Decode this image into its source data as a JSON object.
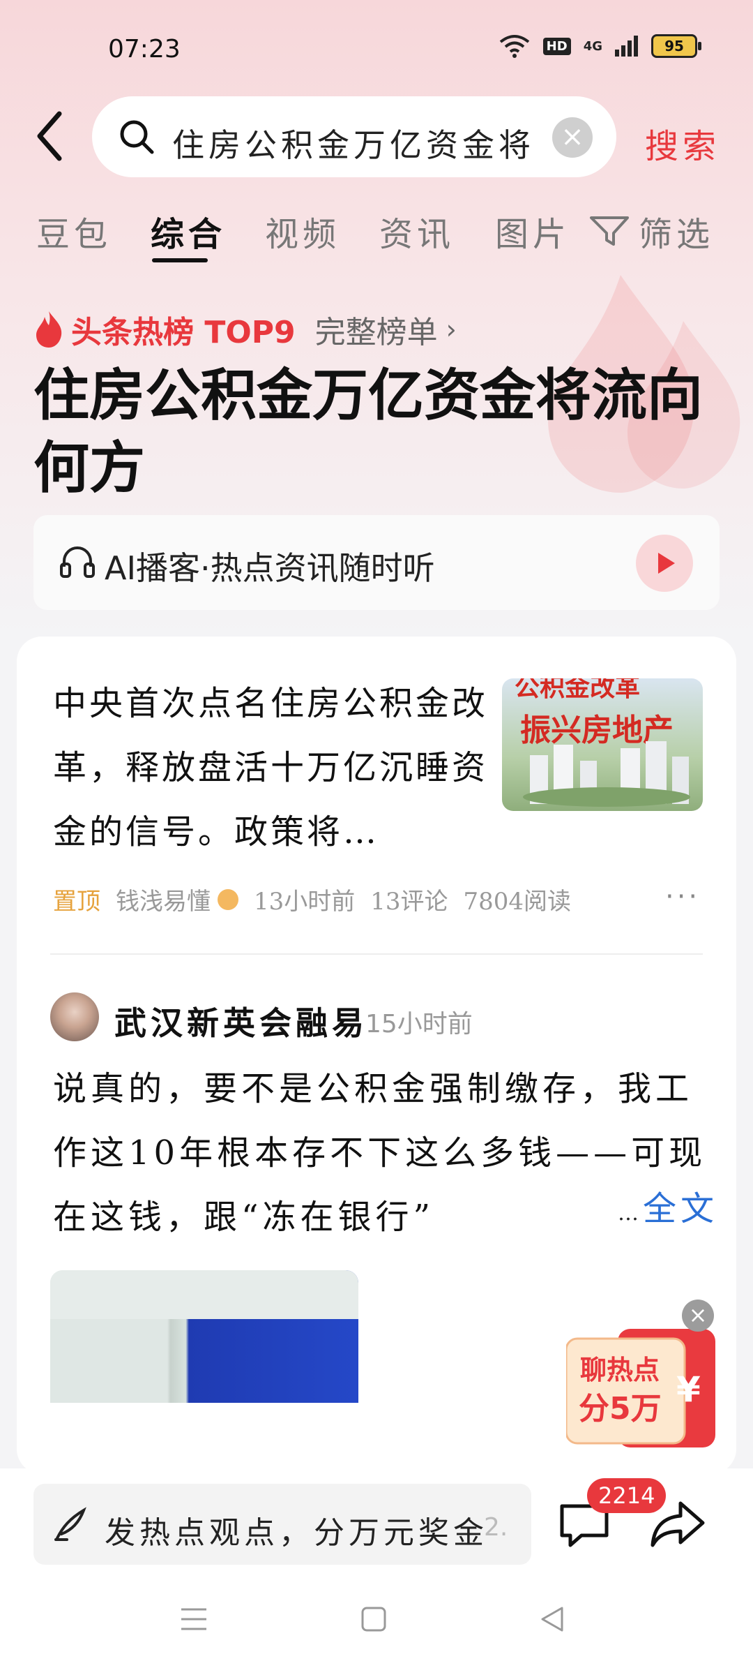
{
  "status": {
    "time": "07:23",
    "network": "4G",
    "hd": "HD",
    "battery": "95"
  },
  "search": {
    "query": "住房公积金万亿资金将",
    "button": "搜索"
  },
  "tabs": [
    "豆包",
    "综合",
    "视频",
    "资讯",
    "图片",
    "筛选"
  ],
  "active_tab": "综合",
  "hot": {
    "label": "头条热榜 TOP9",
    "full_list": "完整榜单"
  },
  "headline": "住房公积金万亿资金将流向何方",
  "ai": {
    "label": "AI播客·热点资讯随时听"
  },
  "article": {
    "text": "中央首次点名住房公积金改革，释放盘活十万亿沉睡资金的信号。政策将…",
    "thumb_line1": "公积金改革",
    "thumb_line2": "振兴房地产",
    "pin": "置顶",
    "author": "钱浅易懂",
    "time": "13小时前",
    "comments": "13评论",
    "reads": "7804阅读"
  },
  "post": {
    "user": "武汉新英会融易",
    "time": "15小时前",
    "text": "说真的，要不是公积金强制缴存，我工作这10年根本存不下这么多钱——可现在这钱，跟“冻在银行”",
    "ellipsis": "…",
    "full": "全文"
  },
  "coupon": {
    "line1": "聊热点",
    "line2": "分5万",
    "symbol": "¥"
  },
  "bottom": {
    "comment_placeholder": "发热点观点，分万元奖金",
    "fade": "2.",
    "comment_count": "2214"
  },
  "colors": {
    "accent": "#e8383d",
    "link": "#2a6fd6"
  }
}
